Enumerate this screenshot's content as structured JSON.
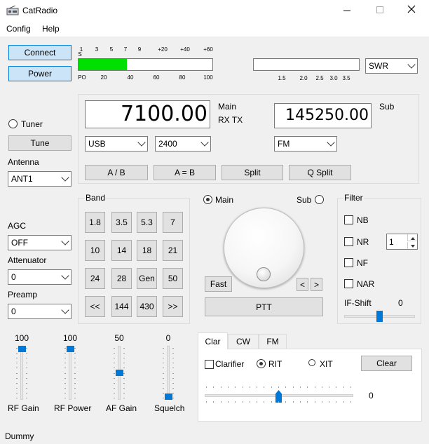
{
  "window": {
    "title": "CatRadio"
  },
  "menu": [
    "Config",
    "Help"
  ],
  "buttons": {
    "connect": "Connect",
    "power": "Power",
    "tune": "Tune",
    "ab": "A / B",
    "aeqb": "A = B",
    "split": "Split",
    "qsplit": "Q Split",
    "fast": "Fast",
    "prev": "<",
    "next": ">",
    "ptt": "PTT",
    "clear": "Clear"
  },
  "meter": {
    "top_scale": [
      "1",
      "3",
      "5",
      "7",
      "9",
      "+20",
      "+40",
      "+60"
    ],
    "s_label": "S",
    "po_label": "PO",
    "bottom_scale": [
      "20",
      "40",
      "60",
      "80",
      "100"
    ],
    "level_fraction": 0.36,
    "swr_scale": [
      "1.5",
      "2.0",
      "2.5",
      "3.0",
      "3.5"
    ],
    "swr_select": "SWR",
    "bar_color": "#00e000"
  },
  "main_vfo": {
    "freq": "7100.00",
    "label": "Main",
    "rxtx": "RX TX",
    "mode": "USB",
    "bandwidth": "2400"
  },
  "sub_vfo": {
    "freq": "145250.00",
    "label": "Sub",
    "mode": "FM"
  },
  "tuner": {
    "label": "Tuner",
    "checked": false
  },
  "antenna": {
    "label": "Antenna",
    "value": "ANT1"
  },
  "agc": {
    "label": "AGC",
    "value": "OFF"
  },
  "attenuator": {
    "label": "Attenuator",
    "value": "0"
  },
  "preamp": {
    "label": "Preamp",
    "value": "0"
  },
  "band": {
    "title": "Band",
    "rows": [
      [
        "1.8",
        "3.5",
        "5.3",
        "7"
      ],
      [
        "10",
        "14",
        "18",
        "21"
      ],
      [
        "24",
        "28",
        "Gen",
        "50"
      ],
      [
        "<<",
        "144",
        "430",
        ">>"
      ]
    ]
  },
  "vfo_select": {
    "main": "Main",
    "sub": "Sub",
    "selected": "Main"
  },
  "filter": {
    "title": "Filter",
    "nb": "NB",
    "nr": "NR",
    "nr_value": "1",
    "nf": "NF",
    "nar": "NAR",
    "ifshift_label": "IF-Shift",
    "ifshift_value": "0"
  },
  "sliders": [
    {
      "label": "RF Gain",
      "value": "100",
      "level": 1.0
    },
    {
      "label": "RF Power",
      "value": "100",
      "level": 1.0
    },
    {
      "label": "AF Gain",
      "value": "50",
      "level": 0.5
    },
    {
      "label": "Squelch",
      "value": "0",
      "level": 0.0
    }
  ],
  "tabs": [
    "Clar",
    "CW",
    "FM"
  ],
  "clar": {
    "clarifier": "Clarifier",
    "rit": "RIT",
    "xit": "XIT",
    "selected": "RIT",
    "value": "0"
  },
  "status": "Dummy"
}
